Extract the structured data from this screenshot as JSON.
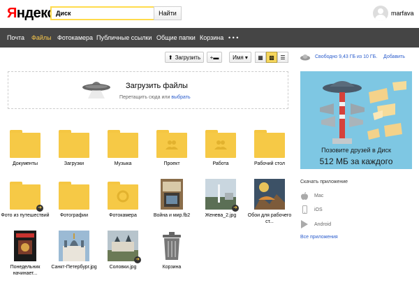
{
  "header": {
    "logo_y": "Я",
    "logo_rest": "ндекс",
    "search_value": "Диск",
    "search_button": "Найти",
    "username": "marfava"
  },
  "nav": {
    "items": [
      "Почта",
      "Файлы",
      "Фотокамера",
      "Публичные ссылки",
      "Общие папки",
      "Корзина",
      "• • •"
    ],
    "active_index": 1,
    "active_color": "#f6c64b"
  },
  "toolbar": {
    "upload_label": "Загрузить",
    "upload_icon": "upload-arrow-icon",
    "newfolder_icon": "new-folder-icon",
    "sort_label": "Имя ▾",
    "view_icons": [
      "large-grid-icon",
      "small-grid-icon",
      "list-icon"
    ],
    "active_view": 1
  },
  "storage": {
    "free_text": "Свободно 9,43 ГБ из 10 ГБ.",
    "add_label": "Добавить"
  },
  "dropzone": {
    "title": "Загрузить файлы",
    "sub_text": "Перетащить сюда или ",
    "choose_link": "выбрать"
  },
  "files": [
    {
      "label": "Документы",
      "kind": "folder"
    },
    {
      "label": "Загрузки",
      "kind": "folder"
    },
    {
      "label": "Музыка",
      "kind": "folder"
    },
    {
      "label": "Проект",
      "kind": "shared-folder"
    },
    {
      "label": "Работа",
      "kind": "shared-folder"
    },
    {
      "label": "Рабочий стол",
      "kind": "folder"
    },
    {
      "label": "Фото из путешествий",
      "kind": "folder",
      "badge": true
    },
    {
      "label": "Фотографии",
      "kind": "folder"
    },
    {
      "label": "Фотокамера",
      "kind": "camera-folder"
    },
    {
      "label": "Война и мир.fb2",
      "kind": "book"
    },
    {
      "label": "Женева_2.jpg",
      "kind": "photo",
      "badge": true
    },
    {
      "label": "Обои для рабочего ст...",
      "kind": "photo"
    },
    {
      "label": "Понедельник начинает...",
      "kind": "book"
    },
    {
      "label": "Санкт-Петербург.jpg",
      "kind": "photo"
    },
    {
      "label": "Соловки.jpg",
      "kind": "photo",
      "badge": true
    },
    {
      "label": "Корзина",
      "kind": "trash"
    }
  ],
  "ad": {
    "line1": "Позовите друзей в Диск",
    "line2": "512 МБ за каждого"
  },
  "apps": {
    "title": "Скачать приложение",
    "items": [
      {
        "label": "Mac",
        "icon": "apple-icon"
      },
      {
        "label": "iOS",
        "icon": "phone-icon"
      },
      {
        "label": "Android",
        "icon": "play-icon"
      }
    ],
    "all_label": "Все приложения"
  }
}
